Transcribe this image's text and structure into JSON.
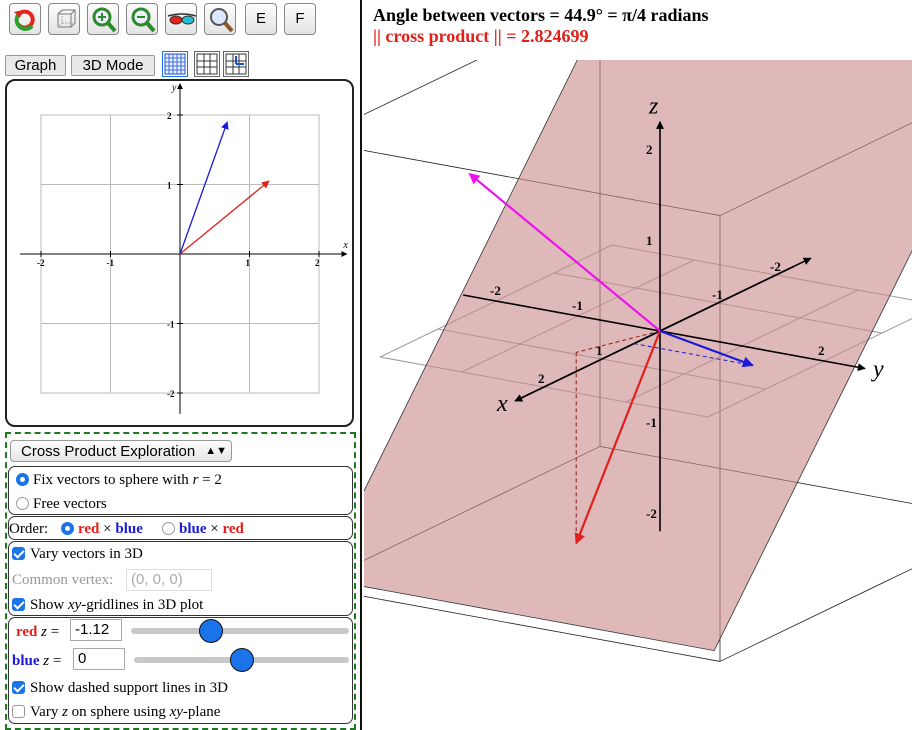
{
  "toolbar": {
    "buttons": [
      "reset-icon",
      "box-icon",
      "zoom-in-icon",
      "zoom-out-icon",
      "glasses-icon",
      "magnifier-icon"
    ],
    "e_label": "E",
    "f_label": "F"
  },
  "mode_buttons": {
    "graph": "Graph",
    "mode3d": "3D Mode"
  },
  "plot2d": {
    "x_axis_label": "x",
    "y_axis_label": "y",
    "x_ticks": [
      "-2",
      "-1",
      "1",
      "2"
    ],
    "y_ticks": [
      "2",
      "1",
      "-1",
      "-2"
    ],
    "vectors": [
      {
        "name": "red",
        "color": "#e0201b",
        "x": 1.28,
        "y": 1.05
      },
      {
        "name": "blue",
        "color": "#1a1ad6",
        "x": 0.68,
        "y": 1.9
      }
    ]
  },
  "controls": {
    "dropdown_value": "Cross Product Exploration",
    "option_fix_prefix": "Fix vectors to sphere with ",
    "option_fix_var": "r",
    "option_fix_suffix": " = 2",
    "option_free": "Free vectors",
    "order_label": "Order:",
    "order_red1": "red",
    "order_times1": "×",
    "order_blue1": "blue",
    "order_blue2": "blue",
    "order_times2": "×",
    "order_red2": "red",
    "vary_3d": "Vary vectors in 3D",
    "common_vertex_label": "Common vertex:",
    "common_vertex_value": "(0, 0, 0)",
    "show_grid_prefix": "Show ",
    "show_grid_var": "xy",
    "show_grid_suffix": "-gridlines in 3D plot",
    "red_z_label": "red",
    "red_z_var": "z",
    "red_z_eq": " =",
    "red_z_value": "-1.12",
    "red_z_slider_fraction": 0.22,
    "blue_z_label": "blue",
    "blue_z_var": "z",
    "blue_z_eq": " =",
    "blue_z_value": "0",
    "blue_z_slider_fraction": 0.5,
    "dashed_lines": "Show dashed support lines in 3D",
    "vary_z_prefix": "Vary ",
    "vary_z_var": "z",
    "vary_z_mid": " on sphere using ",
    "vary_z_var2": "xy",
    "vary_z_suffix": "-plane"
  },
  "checkbox_states": {
    "vary_3d": true,
    "show_grid": true,
    "dashed_lines": true,
    "vary_z": false
  },
  "radio_states": {
    "fix_sphere": true,
    "free": false,
    "order_red_blue": true,
    "order_blue_red": false
  },
  "header": {
    "angle_text": "Angle between vectors  =  44.9°  =  π/4 radians",
    "cross_text": "|| cross product ||  =  2.824699",
    "cross_color": "#e0201b"
  },
  "plot3d": {
    "axis_x": "x",
    "axis_y": "y",
    "axis_z": "z",
    "z_ticks": [
      "2",
      "1",
      "-1",
      "-2"
    ],
    "x_ticks": [
      "-2",
      "-1",
      "1",
      "2"
    ],
    "y_ticks": [
      "-2",
      "-1",
      "2"
    ],
    "plane_color": "#c98a8a",
    "vector_colors": {
      "red": "#e0201b",
      "blue": "#1a1ad6",
      "cross": "#ee11ee"
    }
  }
}
